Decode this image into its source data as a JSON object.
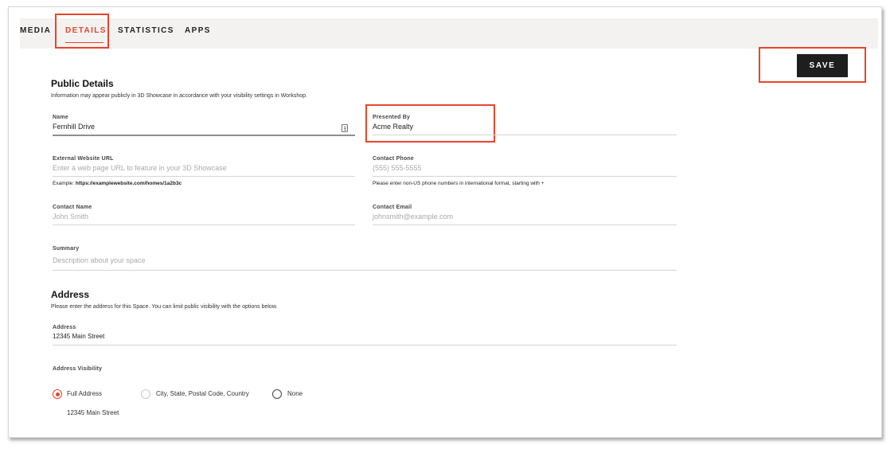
{
  "tabs": {
    "media": "MEDIA",
    "details": "DETAILS",
    "statistics": "STATISTICS",
    "apps": "APPS"
  },
  "save_label": "SAVE",
  "public_details": {
    "title": "Public Details",
    "description": "Information may appear publicly in 3D Showcase in accordance with your visibility settings in Workshop.",
    "name": {
      "label": "Name",
      "value": "Fernhill Drive"
    },
    "presented_by": {
      "label": "Presented By",
      "value": "Acme Realty"
    },
    "external_url": {
      "label": "External Website URL",
      "placeholder": "Enter a web page URL to feature in your 3D Showcase",
      "hint_prefix": "Example:",
      "hint_example": "https://examplewebsite.com/homes/1a2b3c"
    },
    "contact_phone": {
      "label": "Contact Phone",
      "placeholder": "(555) 555-5555",
      "hint": "Please enter non-US phone numbers in international format, starting with +"
    },
    "contact_name": {
      "label": "Contact Name",
      "placeholder": "John Smith"
    },
    "contact_email": {
      "label": "Contact Email",
      "placeholder": "johnsmith@example.com"
    },
    "summary": {
      "label": "Summary",
      "placeholder": "Description about your space"
    }
  },
  "address_section": {
    "title": "Address",
    "description": "Please enter the address for this Space. You can limit public visibility with the options below.",
    "address": {
      "label": "Address",
      "value": "12345 Main Street"
    },
    "visibility_label": "Address Visibility",
    "options": {
      "full": "Full Address",
      "city": "City, State, Postal Code, Country",
      "none": "None"
    },
    "selected": "full",
    "preview": "12345 Main Street"
  },
  "colors": {
    "accent": "#e8452b",
    "button_bg": "#1e1e1e",
    "tabbar_bg": "#f3f2f1"
  }
}
